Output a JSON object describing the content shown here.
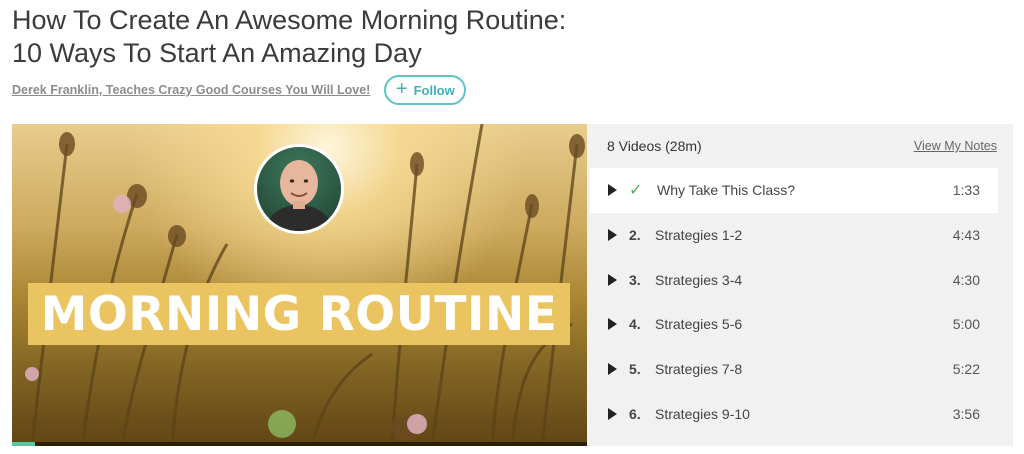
{
  "class": {
    "title_line1": "How To Create An Awesome Morning Routine:",
    "title_line2": "10 Ways To Start An Amazing Day",
    "author": "Derek Franklin, Teaches Crazy Good Courses You Will Love!",
    "follow_label": "Follow"
  },
  "video": {
    "banner_text": "MORNING ROUTINE",
    "progress_fraction": 0.04
  },
  "playlist": {
    "count_label": "8 Videos (28m)",
    "notes_link": "View My Notes",
    "items": [
      {
        "number": "",
        "title": "Why Take This Class?",
        "duration": "1:33",
        "completed": true,
        "active": true
      },
      {
        "number": "2.",
        "title": "Strategies 1-2",
        "duration": "4:43"
      },
      {
        "number": "3.",
        "title": "Strategies 3-4",
        "duration": "4:30"
      },
      {
        "number": "4.",
        "title": "Strategies 5-6",
        "duration": "5:00"
      },
      {
        "number": "5.",
        "title": "Strategies 7-8",
        "duration": "5:22"
      },
      {
        "number": "6.",
        "title": "Strategies 9-10",
        "duration": "3:56"
      }
    ]
  },
  "colors": {
    "accent": "#5ec3c6",
    "banner": "#ebc462",
    "check": "#4caf50"
  }
}
